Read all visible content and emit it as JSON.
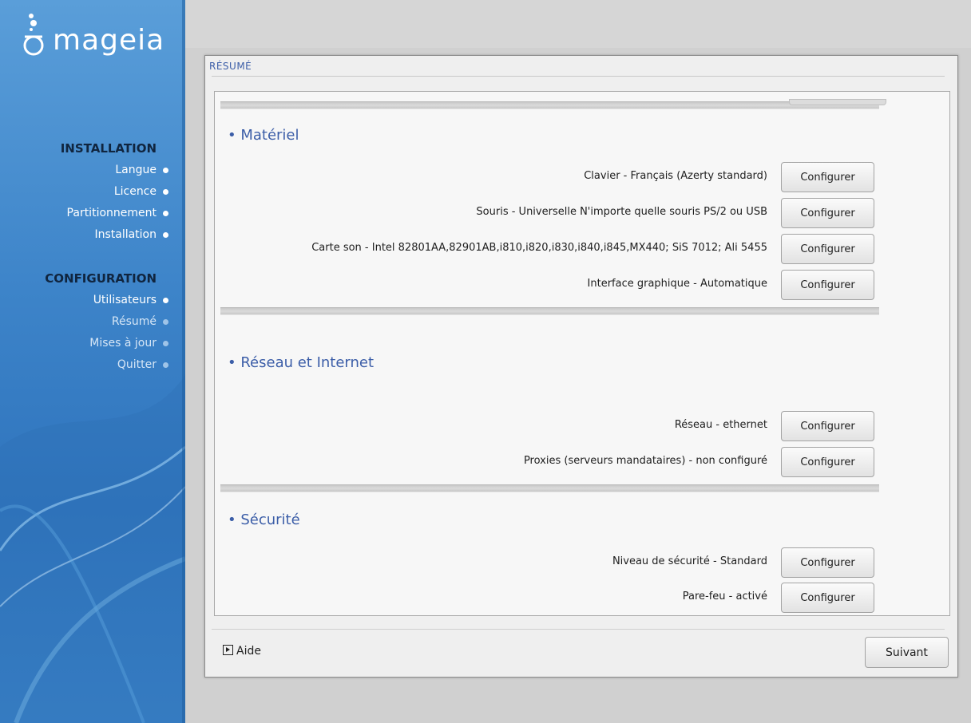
{
  "sidebar": {
    "logo_text": "mageia",
    "sections": [
      {
        "title": "INSTALLATION",
        "steps": [
          "Langue",
          "Licence",
          "Partitionnement",
          "Installation"
        ]
      },
      {
        "title": "CONFIGURATION",
        "steps": [
          "Utilisateurs",
          "Résumé",
          "Mises à jour",
          "Quitter"
        ]
      }
    ]
  },
  "window": {
    "title": "RÉSUMÉ",
    "sections": [
      {
        "heading": "• Matériel",
        "rows": [
          {
            "label": "Clavier - Français (Azerty standard)",
            "button": "Configurer"
          },
          {
            "label": "Souris - Universelle N'importe quelle souris PS/2 ou USB",
            "button": "Configurer"
          },
          {
            "label": "Carte son - Intel 82801AA,82901AB,i810,i820,i830,i840,i845,MX440; SiS 7012; Ali 5455",
            "button": "Configurer"
          },
          {
            "label": "Interface graphique - Automatique",
            "button": "Configurer"
          }
        ]
      },
      {
        "heading": "• Réseau et Internet",
        "rows": [
          {
            "label": "Réseau - ethernet",
            "button": "Configurer"
          },
          {
            "label": "Proxies (serveurs mandataires) - non configuré",
            "button": "Configurer"
          }
        ]
      },
      {
        "heading": "• Sécurité",
        "rows": [
          {
            "label": "Niveau de sécurité - Standard",
            "button": "Configurer"
          },
          {
            "label": "Pare-feu - activé",
            "button": "Configurer"
          }
        ]
      }
    ],
    "help_label": "Aide",
    "next_label": "Suivant"
  },
  "icons": {
    "help": "expand-arrow-icon",
    "step_done": "bullet-dot-icon"
  },
  "colors": {
    "sidebar": "#3d84c9",
    "heading": "#3c5ea8",
    "section_title": "#10253f"
  }
}
